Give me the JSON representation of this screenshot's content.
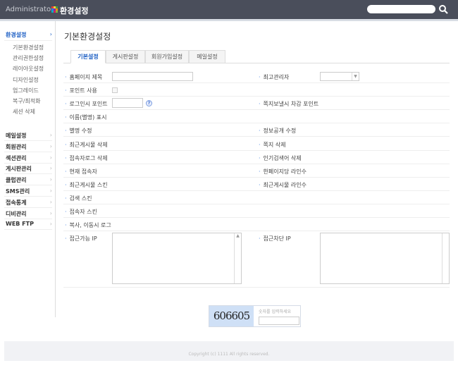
{
  "header": {
    "admin": "Administrator",
    "title": "환경설정",
    "search_placeholder": "",
    "logo_colors": [
      "#e53935",
      "#fdd835",
      "#43a047",
      "#1e88e5",
      "#8e24aa",
      "#fb8c00",
      "#00acc1",
      "#d81b60",
      "#7cb342"
    ]
  },
  "sidebar": {
    "active_section": {
      "label": "환경설정",
      "arrow": "›"
    },
    "sub_items": [
      "기본환경설정",
      "관리권한설정",
      "레이아웃설정",
      "디자인설정",
      "업그레이드",
      "복구/최적화",
      "세션 삭제"
    ],
    "sections": [
      "메일설정",
      "회원관리",
      "섹션관리",
      "게시판관리",
      "클럽관리",
      "SMS관리",
      "접속통계",
      "디비관리",
      "WEB FTP"
    ],
    "arrow": "›"
  },
  "main": {
    "title": "기본환경설정",
    "tabs": [
      "기본설정",
      "게시판설정",
      "회원가입설정",
      "메일설정"
    ],
    "rows": [
      {
        "left": "홈페이지 제목",
        "right": "최고관리자"
      },
      {
        "left": "포인트 사용",
        "right": ""
      },
      {
        "left": "로그인시 포인트",
        "right": "쪽지보낼시 차감 포인트"
      },
      {
        "left": "이름(별명) 표시",
        "right": ""
      },
      {
        "left": "별명 수정",
        "right": "정보공개 수정"
      },
      {
        "left": "최근게시물 삭제",
        "right": "쪽지 삭제"
      },
      {
        "left": "접속자로그 삭제",
        "right": "인기검색어 삭제"
      },
      {
        "left": "현재 접속자",
        "right": "한페이지당 라인수"
      },
      {
        "left": "최근게시물 스킨",
        "right": "최근게시물 라인수"
      },
      {
        "left": "검색 스킨",
        "right": ""
      },
      {
        "left": "접속자 스킨",
        "right": ""
      },
      {
        "left": "복사, 이동시 로그",
        "right": ""
      }
    ],
    "ip_allow": "접근가능 IP",
    "ip_block": "접근차단 IP",
    "help": "?"
  },
  "captcha": {
    "code": "606605",
    "hint": "숫자를 입력하세요"
  },
  "footer": {
    "copyright": "Copyright (c) 1111 All rights reserved."
  }
}
